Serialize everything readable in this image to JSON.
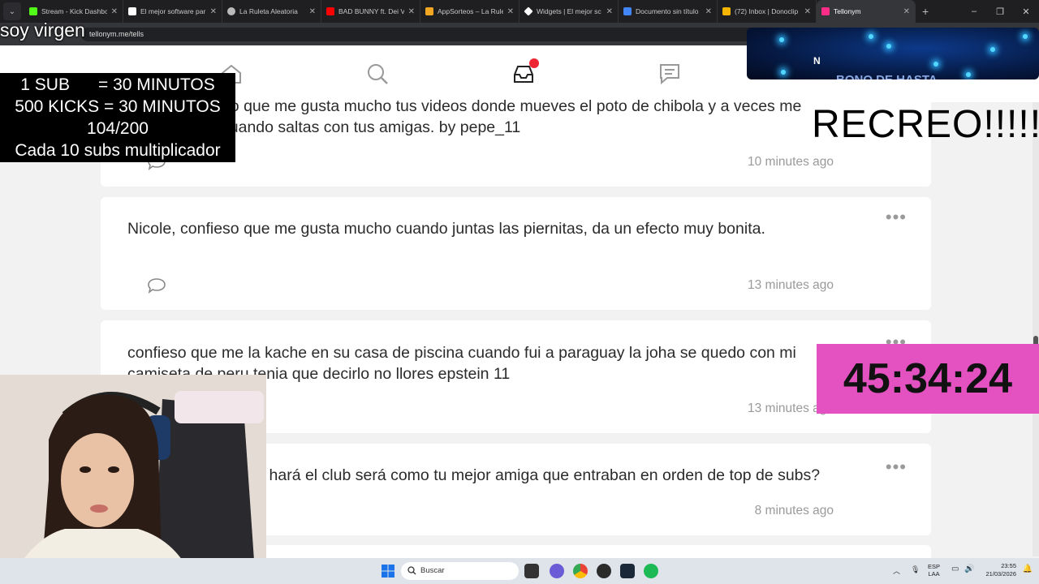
{
  "browser": {
    "tabs": [
      {
        "label": "Stream - Kick Dashbc",
        "color": "#53fc18"
      },
      {
        "label": "El mejor software par",
        "color": "#ffffff"
      },
      {
        "label": "La Ruleta Aleatoria",
        "color": "#bbbbbb"
      },
      {
        "label": "BAD BUNNY ft. Dei V",
        "color": "#ff0000"
      },
      {
        "label": "AppSorteos – La Rule",
        "color": "#f5a623"
      },
      {
        "label": "Widgets | El mejor sc",
        "color": "#ffffff"
      },
      {
        "label": "Documento sin título",
        "color": "#4285f4"
      },
      {
        "label": "(72) Inbox | Donoclip",
        "color": "#f7b500"
      },
      {
        "label": "Tellonym",
        "color": "#ff2d87"
      }
    ],
    "url": "tellonym.me/tells",
    "new_tab": "+",
    "window_controls": [
      "–",
      "❐",
      "✕"
    ]
  },
  "site": {
    "nav_icons": [
      "home-icon",
      "search-icon",
      "inbox-icon",
      "chat-icon"
    ],
    "notification_color": "#ee2533"
  },
  "tells": [
    {
      "text": "Nicole, confieso que me gusta mucho tus videos donde mueves el poto de chibola y a veces me pajeo viendo cuando saltas con tus amigas. by pepe_11",
      "time": "10 minutes ago"
    },
    {
      "text": "Nicole, confieso que me gusta mucho cuando juntas las piernitas, da un efecto muy bonita.",
      "time": "13 minutes ago"
    },
    {
      "text": "confieso que me la kache en su casa de piscina cuando fui a paraguay la joha se quedo con mi camiseta de peru tenia que decirlo no llores epstein 11",
      "time": "13 minutes ago"
    },
    {
      "text": "¿Quién de tus subs hará el club será como tu mejor amiga que entraban en orden de top de subs?",
      "time": "8 minutes ago"
    }
  ],
  "overlays": {
    "soy": "soy virgen",
    "subs_lines": [
      "1 SUB      = 30 MINUTOS",
      "500 KICKS = 30 MINUTOS",
      "104/200",
      "Cada 10 subs multiplicador"
    ],
    "recreo": "RECREO!!!!!",
    "bono_letter": "N",
    "bono_text": "BONO DE HASTA",
    "timer": "45:34:24"
  },
  "taskbar": {
    "search_placeholder": "Buscar",
    "lang_top": "ESP",
    "lang_bottom": "LAA",
    "time": "23:55",
    "date": "21/03/2026"
  }
}
